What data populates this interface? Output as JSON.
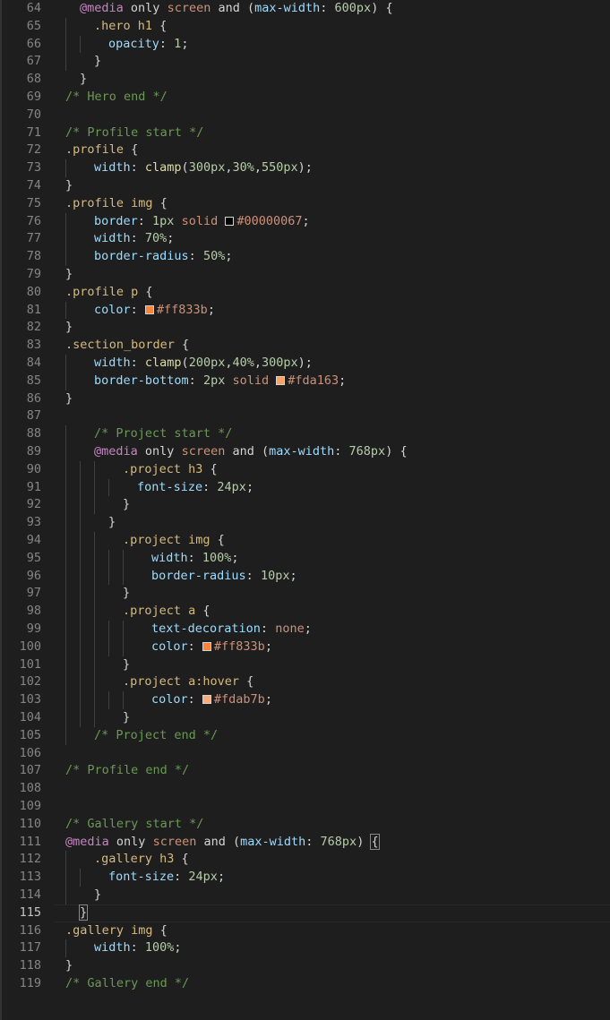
{
  "editor": {
    "colors": {
      "background": "#1e1e1e",
      "line_number": "#858585",
      "line_number_active": "#c6c6c6",
      "plain": "#d4d4d4",
      "selector": "#d7ba7d",
      "property": "#9cdcfe",
      "value_number": "#b5cea8",
      "value_keyword": "#ce9178",
      "at_rule": "#c586c0",
      "media_keyword": "#d4d4d4",
      "comment": "#6a9955",
      "function": "#dcdcaa"
    },
    "active_line": 115,
    "lines": [
      {
        "n": 64,
        "indent": 1,
        "tokens": [
          [
            "at",
            "@media"
          ],
          [
            "p",
            " only "
          ],
          [
            "kw",
            "screen"
          ],
          [
            "p",
            " and ("
          ],
          [
            "prop",
            "max-width"
          ],
          [
            "p",
            ": "
          ],
          [
            "num",
            "600px"
          ],
          [
            "p",
            ") {"
          ]
        ]
      },
      {
        "n": 65,
        "indent": 2,
        "tokens": [
          [
            "sel",
            ".hero h1"
          ],
          [
            "p",
            " {"
          ]
        ]
      },
      {
        "n": 66,
        "indent": 3,
        "tokens": [
          [
            "prop",
            "opacity"
          ],
          [
            "p",
            ": "
          ],
          [
            "num",
            "1"
          ],
          [
            "p",
            ";"
          ]
        ]
      },
      {
        "n": 67,
        "indent": 2,
        "tokens": [
          [
            "p",
            "}"
          ]
        ]
      },
      {
        "n": 68,
        "indent": 1,
        "tokens": [
          [
            "p",
            "}"
          ]
        ]
      },
      {
        "n": 69,
        "indent": 0,
        "tokens": [
          [
            "cmt",
            "/* Hero end */"
          ]
        ]
      },
      {
        "n": 70,
        "indent": 0,
        "tokens": []
      },
      {
        "n": 71,
        "indent": 0,
        "tokens": [
          [
            "cmt",
            "/* Profile start */"
          ]
        ]
      },
      {
        "n": 72,
        "indent": 0,
        "tokens": [
          [
            "sel",
            ".profile"
          ],
          [
            "p",
            " {"
          ]
        ]
      },
      {
        "n": 73,
        "indent": 2,
        "tokens": [
          [
            "prop",
            "width"
          ],
          [
            "p",
            ": "
          ],
          [
            "fn",
            "clamp"
          ],
          [
            "p",
            "("
          ],
          [
            "num",
            "300px"
          ],
          [
            "p",
            ","
          ],
          [
            "num",
            "30%"
          ],
          [
            "p",
            ","
          ],
          [
            "num",
            "550px"
          ],
          [
            "p",
            ");"
          ]
        ]
      },
      {
        "n": 74,
        "indent": 0,
        "tokens": [
          [
            "p",
            "}"
          ]
        ]
      },
      {
        "n": 75,
        "indent": 0,
        "tokens": [
          [
            "sel",
            ".profile img"
          ],
          [
            "p",
            " {"
          ]
        ]
      },
      {
        "n": 76,
        "indent": 2,
        "tokens": [
          [
            "prop",
            "border"
          ],
          [
            "p",
            ": "
          ],
          [
            "num",
            "1px"
          ],
          [
            "p",
            " "
          ],
          [
            "kw",
            "solid"
          ],
          [
            "p",
            " "
          ],
          [
            "swatch",
            "#00000067"
          ],
          [
            "kw",
            "#00000067"
          ],
          [
            "p",
            ";"
          ]
        ]
      },
      {
        "n": 77,
        "indent": 2,
        "tokens": [
          [
            "prop",
            "width"
          ],
          [
            "p",
            ": "
          ],
          [
            "num",
            "70%"
          ],
          [
            "p",
            ";"
          ]
        ]
      },
      {
        "n": 78,
        "indent": 2,
        "tokens": [
          [
            "prop",
            "border-radius"
          ],
          [
            "p",
            ": "
          ],
          [
            "num",
            "50%"
          ],
          [
            "p",
            ";"
          ]
        ]
      },
      {
        "n": 79,
        "indent": 0,
        "tokens": [
          [
            "p",
            "}"
          ]
        ]
      },
      {
        "n": 80,
        "indent": 0,
        "tokens": [
          [
            "sel",
            ".profile p"
          ],
          [
            "p",
            " {"
          ]
        ]
      },
      {
        "n": 81,
        "indent": 2,
        "tokens": [
          [
            "prop",
            "color"
          ],
          [
            "p",
            ": "
          ],
          [
            "swatch",
            "#ff833b"
          ],
          [
            "kw",
            "#ff833b"
          ],
          [
            "p",
            ";"
          ]
        ]
      },
      {
        "n": 82,
        "indent": 0,
        "tokens": [
          [
            "p",
            "}"
          ]
        ]
      },
      {
        "n": 83,
        "indent": 0,
        "tokens": [
          [
            "sel",
            ".section_border"
          ],
          [
            "p",
            " {"
          ]
        ]
      },
      {
        "n": 84,
        "indent": 2,
        "tokens": [
          [
            "prop",
            "width"
          ],
          [
            "p",
            ": "
          ],
          [
            "fn",
            "clamp"
          ],
          [
            "p",
            "("
          ],
          [
            "num",
            "200px"
          ],
          [
            "p",
            ","
          ],
          [
            "num",
            "40%"
          ],
          [
            "p",
            ","
          ],
          [
            "num",
            "300px"
          ],
          [
            "p",
            ");"
          ]
        ]
      },
      {
        "n": 85,
        "indent": 2,
        "tokens": [
          [
            "prop",
            "border-bottom"
          ],
          [
            "p",
            ": "
          ],
          [
            "num",
            "2px"
          ],
          [
            "p",
            " "
          ],
          [
            "kw",
            "solid"
          ],
          [
            "p",
            " "
          ],
          [
            "swatch",
            "#fda163"
          ],
          [
            "kw",
            "#fda163"
          ],
          [
            "p",
            ";"
          ]
        ]
      },
      {
        "n": 86,
        "indent": 0,
        "tokens": [
          [
            "p",
            "}"
          ]
        ]
      },
      {
        "n": 87,
        "indent": 0,
        "tokens": []
      },
      {
        "n": 88,
        "indent": 2,
        "tokens": [
          [
            "cmt",
            "/* Project start */"
          ]
        ]
      },
      {
        "n": 89,
        "indent": 2,
        "tokens": [
          [
            "at",
            "@media"
          ],
          [
            "p",
            " only "
          ],
          [
            "kw",
            "screen"
          ],
          [
            "p",
            " and ("
          ],
          [
            "prop",
            "max-width"
          ],
          [
            "p",
            ": "
          ],
          [
            "num",
            "768px"
          ],
          [
            "p",
            ") {"
          ]
        ]
      },
      {
        "n": 90,
        "indent": 4,
        "tokens": [
          [
            "sel",
            ".project h3"
          ],
          [
            "p",
            " {"
          ]
        ]
      },
      {
        "n": 91,
        "indent": 5,
        "tokens": [
          [
            "prop",
            "font-size"
          ],
          [
            "p",
            ": "
          ],
          [
            "num",
            "24px"
          ],
          [
            "p",
            ";"
          ]
        ]
      },
      {
        "n": 92,
        "indent": 4,
        "tokens": [
          [
            "p",
            "}"
          ]
        ]
      },
      {
        "n": 93,
        "indent": 3,
        "tokens": [
          [
            "p",
            "}"
          ]
        ]
      },
      {
        "n": 94,
        "indent": 4,
        "tokens": [
          [
            "sel",
            ".project img"
          ],
          [
            "p",
            " {"
          ]
        ]
      },
      {
        "n": 95,
        "indent": 6,
        "tokens": [
          [
            "prop",
            "width"
          ],
          [
            "p",
            ": "
          ],
          [
            "num",
            "100%"
          ],
          [
            "p",
            ";"
          ]
        ]
      },
      {
        "n": 96,
        "indent": 6,
        "tokens": [
          [
            "prop",
            "border-radius"
          ],
          [
            "p",
            ": "
          ],
          [
            "num",
            "10px"
          ],
          [
            "p",
            ";"
          ]
        ]
      },
      {
        "n": 97,
        "indent": 4,
        "tokens": [
          [
            "p",
            "}"
          ]
        ]
      },
      {
        "n": 98,
        "indent": 4,
        "tokens": [
          [
            "sel",
            ".project a"
          ],
          [
            "p",
            " {"
          ]
        ]
      },
      {
        "n": 99,
        "indent": 6,
        "tokens": [
          [
            "prop",
            "text-decoration"
          ],
          [
            "p",
            ": "
          ],
          [
            "kw",
            "none"
          ],
          [
            "p",
            ";"
          ]
        ]
      },
      {
        "n": 100,
        "indent": 6,
        "tokens": [
          [
            "prop",
            "color"
          ],
          [
            "p",
            ": "
          ],
          [
            "swatch",
            "#ff833b"
          ],
          [
            "kw",
            "#ff833b"
          ],
          [
            "p",
            ";"
          ]
        ]
      },
      {
        "n": 101,
        "indent": 4,
        "tokens": [
          [
            "p",
            "}"
          ]
        ]
      },
      {
        "n": 102,
        "indent": 4,
        "tokens": [
          [
            "sel",
            ".project a:hover"
          ],
          [
            "p",
            " {"
          ]
        ]
      },
      {
        "n": 103,
        "indent": 6,
        "tokens": [
          [
            "prop",
            "color"
          ],
          [
            "p",
            ": "
          ],
          [
            "swatch",
            "#fdab7b"
          ],
          [
            "kw",
            "#fdab7b"
          ],
          [
            "p",
            ";"
          ]
        ]
      },
      {
        "n": 104,
        "indent": 4,
        "tokens": [
          [
            "p",
            "}"
          ]
        ]
      },
      {
        "n": 105,
        "indent": 2,
        "tokens": [
          [
            "cmt",
            "/* Project end */"
          ]
        ]
      },
      {
        "n": 106,
        "indent": 0,
        "tokens": []
      },
      {
        "n": 107,
        "indent": 0,
        "tokens": [
          [
            "cmt",
            "/* Profile end */"
          ]
        ]
      },
      {
        "n": 108,
        "indent": 0,
        "tokens": []
      },
      {
        "n": 109,
        "indent": 0,
        "tokens": []
      },
      {
        "n": 110,
        "indent": 0,
        "tokens": [
          [
            "cmt",
            "/* Gallery start */"
          ]
        ]
      },
      {
        "n": 111,
        "indent": 0,
        "tokens": [
          [
            "at",
            "@media"
          ],
          [
            "p",
            " only "
          ],
          [
            "kw",
            "screen"
          ],
          [
            "p",
            " and ("
          ],
          [
            "prop",
            "max-width"
          ],
          [
            "p",
            ": "
          ],
          [
            "num",
            "768px"
          ],
          [
            "p",
            ") "
          ],
          [
            "bracket",
            "{"
          ]
        ]
      },
      {
        "n": 112,
        "indent": 2,
        "tokens": [
          [
            "sel",
            ".gallery h3"
          ],
          [
            "p",
            " {"
          ]
        ]
      },
      {
        "n": 113,
        "indent": 3,
        "tokens": [
          [
            "prop",
            "font-size"
          ],
          [
            "p",
            ": "
          ],
          [
            "num",
            "24px"
          ],
          [
            "p",
            ";"
          ]
        ]
      },
      {
        "n": 114,
        "indent": 2,
        "tokens": [
          [
            "p",
            "}"
          ]
        ]
      },
      {
        "n": 115,
        "indent": 1,
        "tokens": [
          [
            "bracket",
            "}"
          ],
          [
            "cursor",
            ""
          ]
        ]
      },
      {
        "n": 116,
        "indent": 0,
        "tokens": [
          [
            "sel",
            ".gallery img"
          ],
          [
            "p",
            " {"
          ]
        ]
      },
      {
        "n": 117,
        "indent": 2,
        "tokens": [
          [
            "prop",
            "width"
          ],
          [
            "p",
            ": "
          ],
          [
            "num",
            "100%"
          ],
          [
            "p",
            ";"
          ]
        ]
      },
      {
        "n": 118,
        "indent": 0,
        "tokens": [
          [
            "p",
            "}"
          ]
        ]
      },
      {
        "n": 119,
        "indent": 0,
        "tokens": [
          [
            "cmt",
            "/* Gallery end */"
          ]
        ]
      }
    ]
  }
}
